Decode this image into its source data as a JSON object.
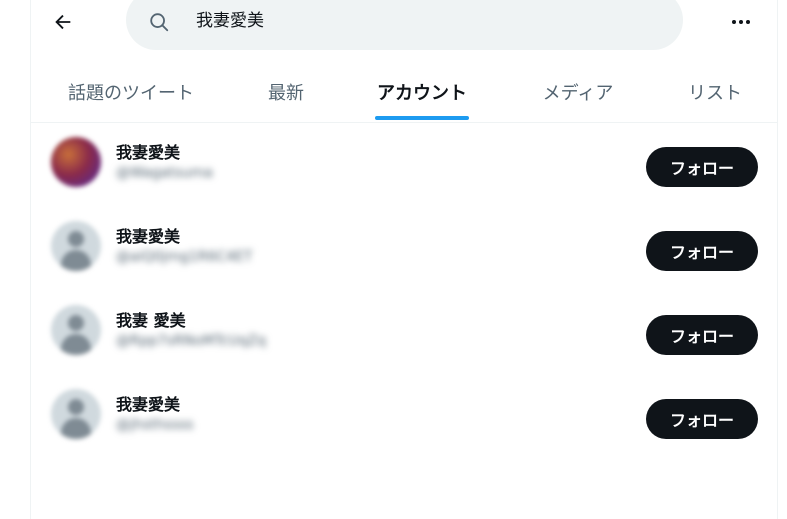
{
  "search": {
    "value": "我妻愛美"
  },
  "tabs": [
    {
      "label": "話題のツイート"
    },
    {
      "label": "最新"
    },
    {
      "label": "アカウント"
    },
    {
      "label": "メディア"
    },
    {
      "label": "リスト"
    }
  ],
  "active_tab_color": "#1d9bf0",
  "icons": [
    "back-arrow-icon",
    "search-icon",
    "more-icon"
  ],
  "accounts": [
    {
      "name": "我妻愛美",
      "handle": "@Wagatsuma",
      "follow_label": "フォロー",
      "avatar": "custom"
    },
    {
      "name": "我妻愛美",
      "handle": "@aiQ0jmg1R6C4ET",
      "follow_label": "フォロー",
      "avatar": "default"
    },
    {
      "name": "我妻 愛美",
      "handle": "@Rpp7sRNoMTcUqZq",
      "follow_label": "フォロー",
      "avatar": "default"
    },
    {
      "name": "我妻愛美",
      "handle": "@jhsthssss",
      "follow_label": "フォロー",
      "avatar": "default"
    }
  ]
}
